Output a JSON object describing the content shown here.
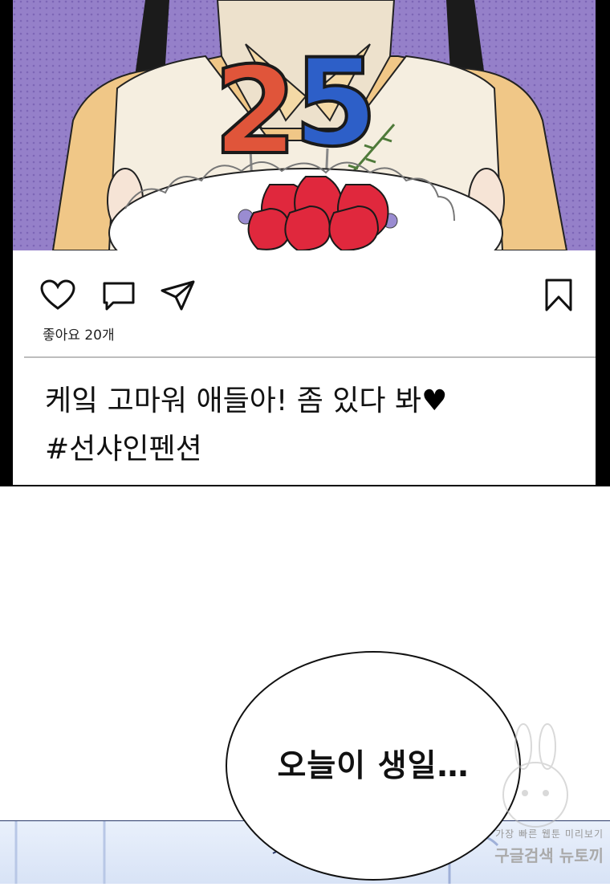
{
  "post": {
    "likes_text": "좋아요 20개",
    "caption_line1": "케잌 고마워 애들아! 좀 있다 봐",
    "caption_heart": "♥",
    "caption_line2": "#선샤인펜션",
    "icons": [
      "heart-icon",
      "comment-icon",
      "share-icon",
      "bookmark-icon"
    ]
  },
  "bubble": {
    "text": "오늘이 생일…"
  },
  "watermark": {
    "line1": "가장 빠른 웹툰 미리보기",
    "line2": "구글검색 뉴토끼"
  },
  "cake_numbers": [
    "2",
    "5"
  ],
  "colors": {
    "background_purple": "#8f78c6",
    "number_red": "#e0553a",
    "number_blue": "#2d5fc8"
  }
}
